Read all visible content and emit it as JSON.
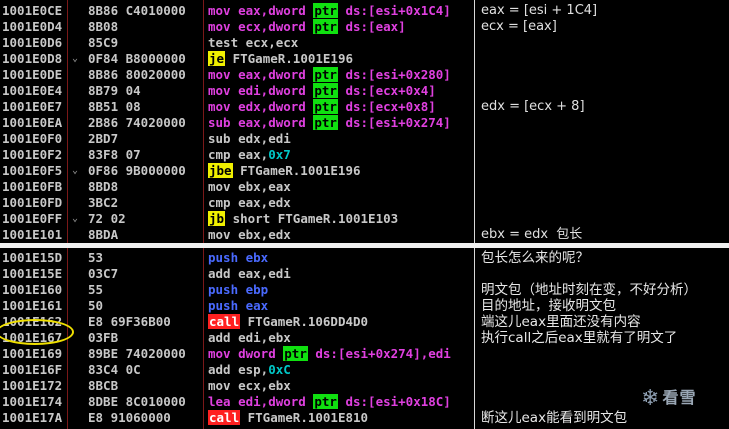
{
  "top_rows": [
    {
      "addr": "1001E0CE",
      "mark": "",
      "hex": "8B86 C4010000",
      "asm": [
        {
          "t": "mov eax,dword ",
          "c": "purple"
        },
        {
          "t": "ptr",
          "c": "ptr"
        },
        {
          "t": " ds:[esi+0x1C4]",
          "c": "purple"
        }
      ],
      "comment": "eax = [esi + 1C4]"
    },
    {
      "addr": "1001E0D4",
      "mark": "",
      "hex": "8B08",
      "asm": [
        {
          "t": "mov ecx,dword ",
          "c": "purple"
        },
        {
          "t": "ptr",
          "c": "ptr"
        },
        {
          "t": " ds:[eax]",
          "c": "purple"
        }
      ],
      "comment": "ecx = [eax]"
    },
    {
      "addr": "1001E0D6",
      "mark": "",
      "hex": "85C9",
      "asm": [
        {
          "t": "test ecx,ecx",
          "c": "plain"
        }
      ],
      "comment": ""
    },
    {
      "addr": "1001E0D8",
      "mark": "⌄",
      "hex": "0F84 B8000000",
      "asm": [
        {
          "t": "je",
          "c": "yellow"
        },
        {
          "t": " FTGameR.1001E196",
          "c": "plain"
        }
      ],
      "comment": ""
    },
    {
      "addr": "1001E0DE",
      "mark": "",
      "hex": "8B86 80020000",
      "asm": [
        {
          "t": "mov eax,dword ",
          "c": "purple"
        },
        {
          "t": "ptr",
          "c": "ptr"
        },
        {
          "t": " ds:[esi+0x280]",
          "c": "purple"
        }
      ],
      "comment": ""
    },
    {
      "addr": "1001E0E4",
      "mark": "",
      "hex": "8B79 04",
      "asm": [
        {
          "t": "mov edi,dword ",
          "c": "purple"
        },
        {
          "t": "ptr",
          "c": "ptr"
        },
        {
          "t": " ds:[ecx+0x4]",
          "c": "purple"
        }
      ],
      "comment": ""
    },
    {
      "addr": "1001E0E7",
      "mark": "",
      "hex": "8B51 08",
      "asm": [
        {
          "t": "mov edx,dword ",
          "c": "purple"
        },
        {
          "t": "ptr",
          "c": "ptr"
        },
        {
          "t": " ds:[ecx+0x8]",
          "c": "purple"
        }
      ],
      "comment": "edx = [ecx + 8]"
    },
    {
      "addr": "1001E0EA",
      "mark": "",
      "hex": "2B86 74020000",
      "asm": [
        {
          "t": "sub eax,dword ",
          "c": "purple"
        },
        {
          "t": "ptr",
          "c": "ptr"
        },
        {
          "t": " ds:[esi+0x274]",
          "c": "purple"
        }
      ],
      "comment": ""
    },
    {
      "addr": "1001E0F0",
      "mark": "",
      "hex": "2BD7",
      "asm": [
        {
          "t": "sub edx,edi",
          "c": "plain"
        }
      ],
      "comment": ""
    },
    {
      "addr": "1001E0F2",
      "mark": "",
      "hex": "83F8 07",
      "asm": [
        {
          "t": "cmp eax,",
          "c": "plain"
        },
        {
          "t": "0x7",
          "c": "cyan"
        }
      ],
      "comment": ""
    },
    {
      "addr": "1001E0F5",
      "mark": "⌄",
      "hex": "0F86 9B000000",
      "asm": [
        {
          "t": "jbe",
          "c": "yellow"
        },
        {
          "t": " FTGameR.1001E196",
          "c": "plain"
        }
      ],
      "comment": ""
    },
    {
      "addr": "1001E0FB",
      "mark": "",
      "hex": "8BD8",
      "asm": [
        {
          "t": "mov ebx,eax",
          "c": "plain"
        }
      ],
      "comment": ""
    },
    {
      "addr": "1001E0FD",
      "mark": "",
      "hex": "3BC2",
      "asm": [
        {
          "t": "cmp eax,edx",
          "c": "plain"
        }
      ],
      "comment": ""
    },
    {
      "addr": "1001E0FF",
      "mark": "⌄",
      "hex": "72 02",
      "asm": [
        {
          "t": "jb",
          "c": "yellow"
        },
        {
          "t": " short FTGameR.1001E103",
          "c": "plain"
        }
      ],
      "comment": ""
    },
    {
      "addr": "1001E101",
      "mark": "",
      "hex": "8BDA",
      "asm": [
        {
          "t": "mov ebx,edx",
          "c": "plain"
        }
      ],
      "comment": "ebx = edx  包长"
    }
  ],
  "bottom_rows": [
    {
      "addr": "1001E15D",
      "mark": "",
      "hex": "53",
      "asm": [
        {
          "t": "push ebx",
          "c": "blue"
        }
      ]
    },
    {
      "addr": "1001E15E",
      "mark": "",
      "hex": "03C7",
      "asm": [
        {
          "t": "add eax,edi",
          "c": "plain"
        }
      ]
    },
    {
      "addr": "1001E160",
      "mark": "",
      "hex": "55",
      "asm": [
        {
          "t": "push ebp",
          "c": "blue"
        }
      ]
    },
    {
      "addr": "1001E161",
      "mark": "",
      "hex": "50",
      "asm": [
        {
          "t": "push eax",
          "c": "blue"
        }
      ]
    },
    {
      "addr": "1001E162",
      "mark": "",
      "hex": "E8 69F36B00",
      "asm": [
        {
          "t": "call",
          "c": "red"
        },
        {
          "t": " FTGameR.106DD4D0",
          "c": "plain"
        }
      ]
    },
    {
      "addr": "1001E167",
      "mark": "",
      "hex": "03FB",
      "asm": [
        {
          "t": "add edi,ebx",
          "c": "plain"
        }
      ]
    },
    {
      "addr": "1001E169",
      "mark": "",
      "hex": "89BE 74020000",
      "asm": [
        {
          "t": "mov dword ",
          "c": "purple"
        },
        {
          "t": "ptr",
          "c": "ptr"
        },
        {
          "t": " ds:[esi+0x274],edi",
          "c": "purple"
        }
      ]
    },
    {
      "addr": "1001E16F",
      "mark": "",
      "hex": "83C4 0C",
      "asm": [
        {
          "t": "add esp,",
          "c": "plain"
        },
        {
          "t": "0xC",
          "c": "cyan"
        }
      ]
    },
    {
      "addr": "1001E172",
      "mark": "",
      "hex": "8BCB",
      "asm": [
        {
          "t": "mov ecx,ebx",
          "c": "plain"
        }
      ]
    },
    {
      "addr": "1001E174",
      "mark": "",
      "hex": "8DBE 8C010000",
      "asm": [
        {
          "t": "lea edi,dword ",
          "c": "purple"
        },
        {
          "t": "ptr",
          "c": "ptr"
        },
        {
          "t": " ds:[esi+0x18C]",
          "c": "purple"
        }
      ]
    },
    {
      "addr": "1001E17A",
      "mark": "",
      "hex": "E8 91060000",
      "asm": [
        {
          "t": "call",
          "c": "red"
        },
        {
          "t": " FTGameR.1001E810",
          "c": "plain"
        }
      ]
    }
  ],
  "notes": [
    {
      "text": "包长怎么来的呢？",
      "row": 0
    },
    {
      "text": "明文包（地址时刻在变，不好分析）",
      "row": 2
    },
    {
      "text": "目的地址，接收明文包",
      "row": 3
    },
    {
      "text": "端这儿eax里面还没有内容",
      "row": 4
    },
    {
      "text": "执行call之后eax里就有了明文了",
      "row": 5
    },
    {
      "text": "断这儿eax能看到明文包",
      "row": 10
    }
  ],
  "watermark": {
    "icon": "snowflake-icon",
    "glyph": "❄",
    "text": "看雪"
  }
}
